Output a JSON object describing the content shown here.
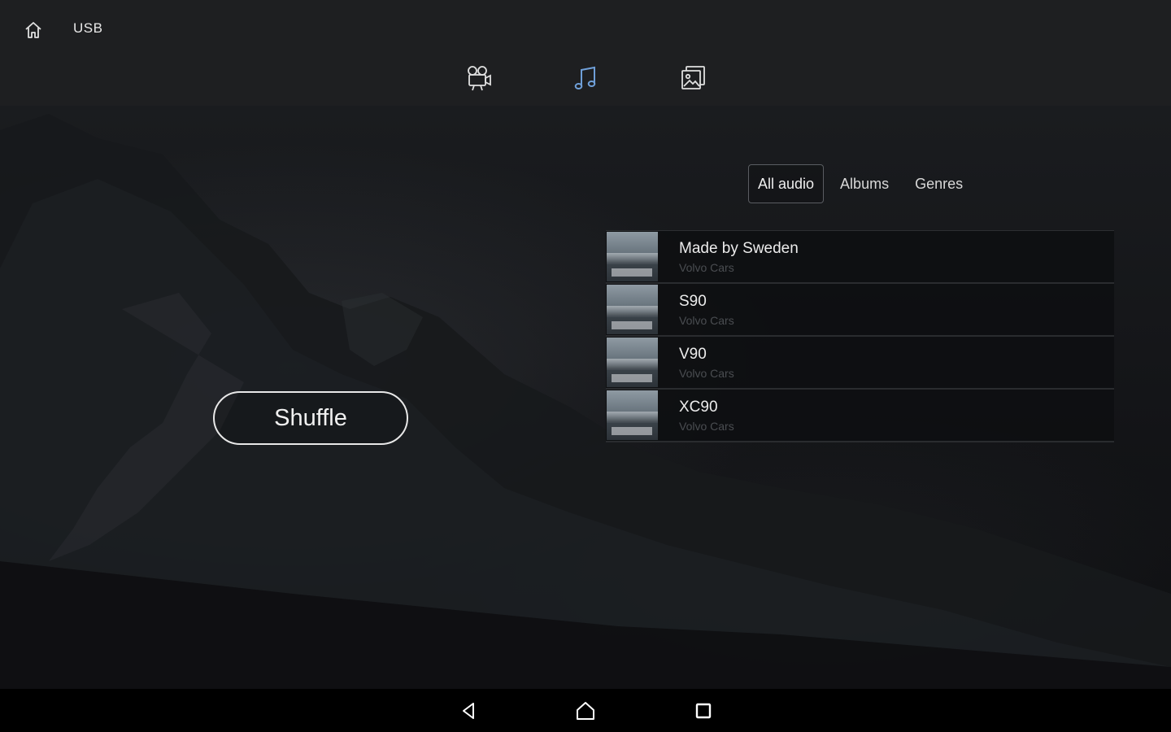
{
  "header": {
    "source": "USB",
    "icons": {
      "home": "home-icon",
      "video": "video-camera-icon",
      "music": "music-note-icon",
      "photos": "photo-gallery-icon"
    },
    "active_tab": "music",
    "colors": {
      "active": "#6f9fd8",
      "inactive": "#e0e0e0"
    }
  },
  "main": {
    "shuffle_label": "Shuffle",
    "filters": [
      {
        "label": "All audio",
        "active": true
      },
      {
        "label": "Albums",
        "active": false
      },
      {
        "label": "Genres",
        "active": false
      }
    ],
    "tracks": [
      {
        "title": "Made by Sweden",
        "artist": "Volvo Cars"
      },
      {
        "title": "S90",
        "artist": "Volvo Cars"
      },
      {
        "title": "V90",
        "artist": "Volvo Cars"
      },
      {
        "title": "XC90",
        "artist": "Volvo Cars"
      }
    ]
  },
  "navbar": {
    "icons": {
      "back": "back-triangle-icon",
      "home": "home-outline-icon",
      "recents": "recents-square-icon"
    }
  }
}
